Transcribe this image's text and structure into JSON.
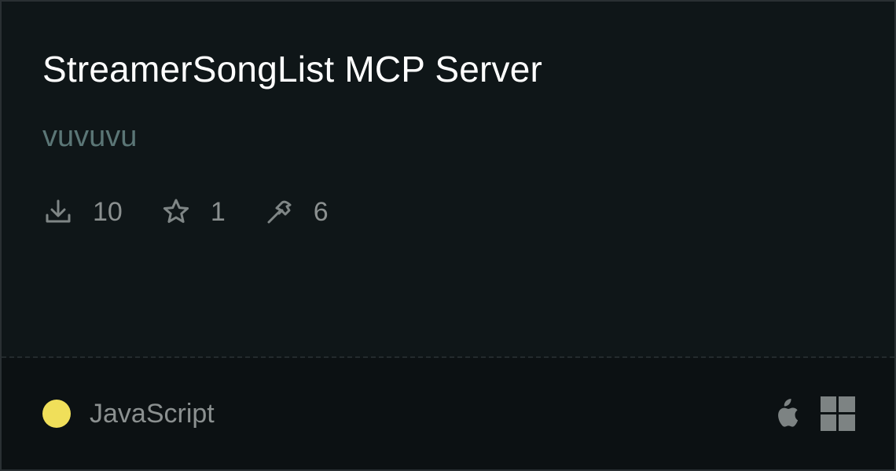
{
  "card": {
    "title": "StreamerSongList MCP Server",
    "author": "vuvuvu",
    "stats": [
      {
        "icon": "download-icon",
        "value": "10"
      },
      {
        "icon": "star-icon",
        "value": "1"
      },
      {
        "icon": "hammer-icon",
        "value": "6"
      }
    ],
    "language": {
      "name": "JavaScript",
      "color": "#f0df5a"
    },
    "platforms": [
      "apple-icon",
      "windows-icon"
    ]
  }
}
